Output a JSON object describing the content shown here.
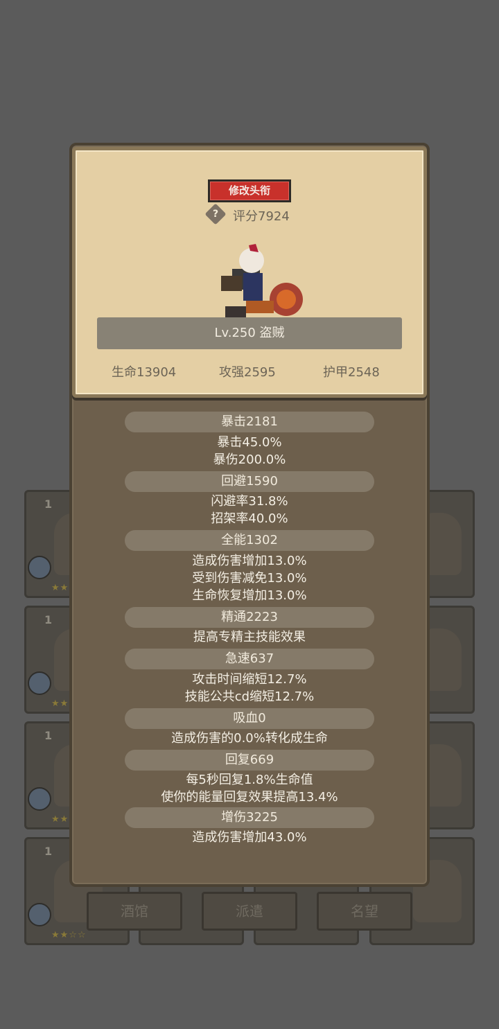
{
  "background": {
    "cards": [
      {
        "level": "1",
        "stars": "★★☆☆"
      },
      {
        "level": "1",
        "stars": "★★☆☆"
      },
      {
        "level": "1",
        "stars": "★★☆☆"
      },
      {
        "level": "1",
        "stars": "★★☆☆"
      }
    ],
    "bottom_buttons": [
      "酒馆",
      "派遣",
      "名望"
    ]
  },
  "colors": {
    "accent": "#c8312b",
    "panel": "#e4cfa4",
    "modal": "#6d5f4c",
    "bar": "#888275"
  },
  "header": {
    "title_button": "修改头衔",
    "help_icon": "?",
    "score": "评分7924",
    "level_class": "Lv.250 盗贼",
    "stats": {
      "hp": "生命13904",
      "attack": "攻强2595",
      "armor": "护甲2548"
    }
  },
  "stat_list": [
    {
      "head": "暴击2181",
      "lines": [
        "暴击45.0%",
        "暴伤200.0%"
      ]
    },
    {
      "head": "回避1590",
      "lines": [
        "闪避率31.8%",
        "招架率40.0%"
      ]
    },
    {
      "head": "全能1302",
      "lines": [
        "造成伤害增加13.0%",
        "受到伤害减免13.0%",
        "生命恢复增加13.0%"
      ]
    },
    {
      "head": "精通2223",
      "lines": [
        "提高专精主技能效果"
      ]
    },
    {
      "head": "急速637",
      "lines": [
        "攻击时间缩短12.7%",
        "技能公共cd缩短12.7%"
      ]
    },
    {
      "head": "吸血0",
      "lines": [
        "造成伤害的0.0%转化成生命"
      ]
    },
    {
      "head": "回复669",
      "lines": [
        "每5秒回复1.8%生命值",
        "使你的能量回复效果提高13.4%"
      ]
    },
    {
      "head": "增伤3225",
      "lines": [
        "造成伤害增加43.0%"
      ]
    }
  ]
}
